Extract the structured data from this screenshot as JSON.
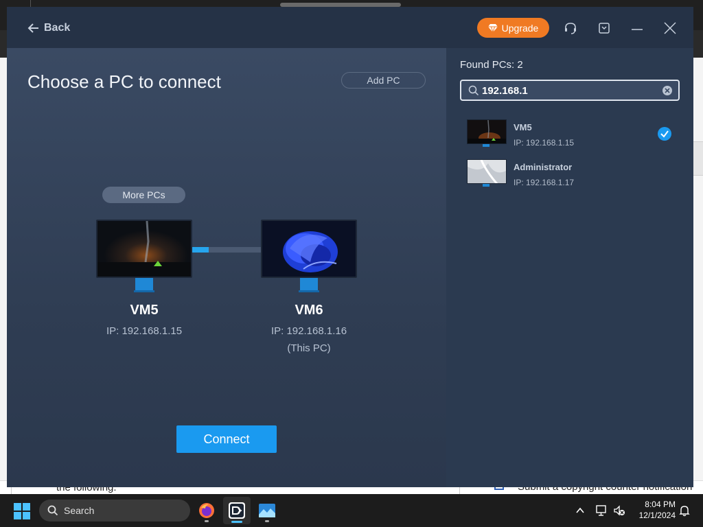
{
  "window": {
    "back_label": "Back",
    "upgrade_label": "Upgrade"
  },
  "left": {
    "title": "Choose a PC to connect",
    "add_pc_label": "Add PC",
    "more_pcs_label": "More PCs",
    "remote_pc": {
      "name": "VM5",
      "ip": "IP: 192.168.1.15"
    },
    "local_pc": {
      "name": "VM6",
      "ip": "IP: 192.168.1.16",
      "note": "(This PC)"
    },
    "connect_label": "Connect"
  },
  "right": {
    "found_label": "Found PCs: 2",
    "search_value": "192.168.1",
    "results": [
      {
        "name": "VM5",
        "ip": "IP: 192.168.1.15",
        "selected": true
      },
      {
        "name": "Administrator",
        "ip": "IP: 192.168.1.17",
        "selected": false
      }
    ]
  },
  "background": {
    "left_text": "the following.",
    "right_text": "Submit a copyright counter notification"
  },
  "taskbar": {
    "search_label": "Search",
    "time": "8:04 PM",
    "date": "12/1/2024"
  },
  "colors": {
    "accent": "#1a9af0",
    "upgrade": "#f07a23",
    "panel": "#334056"
  }
}
